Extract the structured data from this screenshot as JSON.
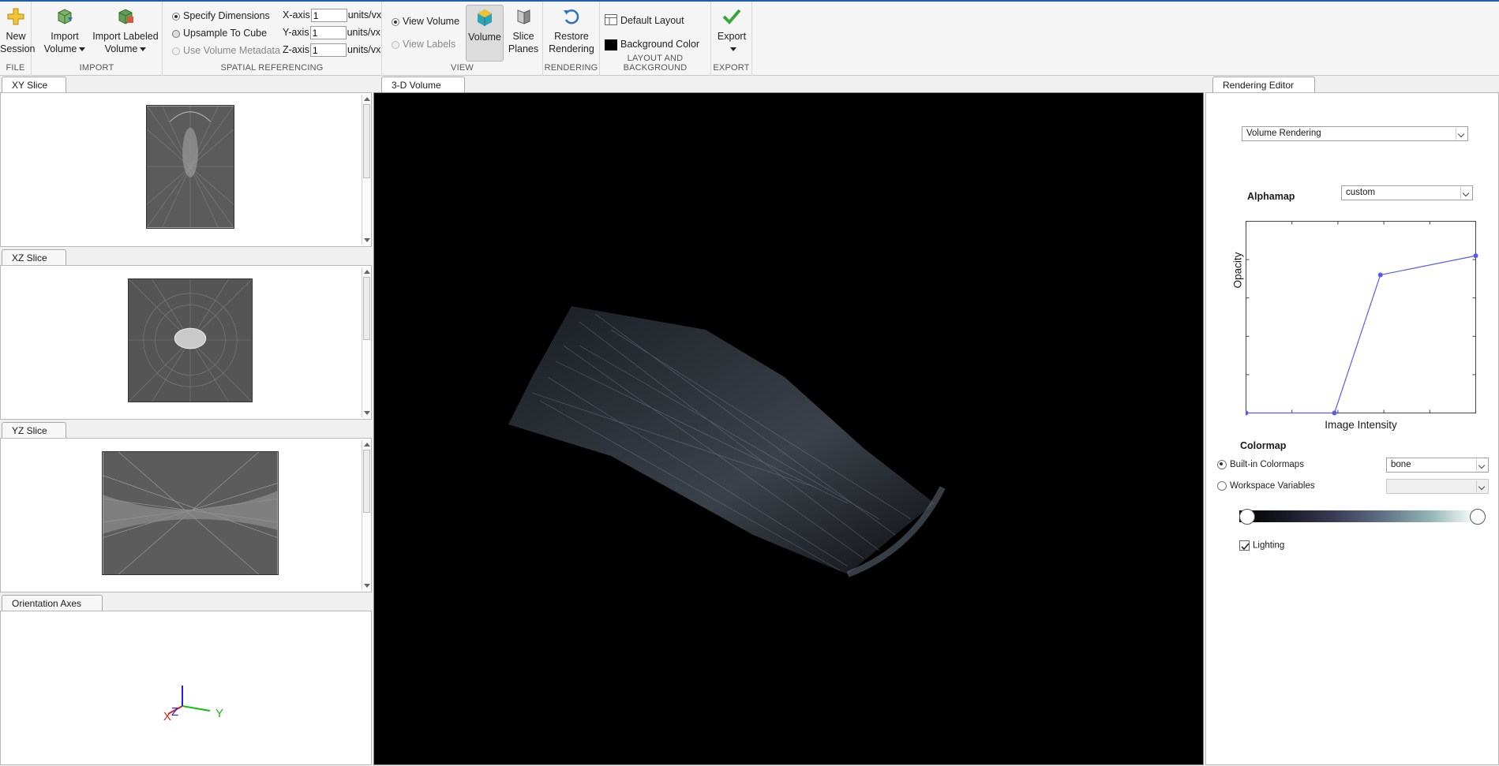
{
  "toolstrip": {
    "file": {
      "title": "FILE",
      "new_session": [
        "New",
        "Session"
      ]
    },
    "import": {
      "title": "IMPORT",
      "import_volume": [
        "Import",
        "Volume"
      ],
      "import_labeled": [
        "Import Labeled",
        "Volume"
      ]
    },
    "spatial": {
      "title": "SPATIAL REFERENCING",
      "options": [
        "Specify Dimensions",
        "Upsample To Cube",
        "Use Volume Metadata"
      ],
      "axes": [
        {
          "label": "X-axis",
          "value": "1",
          "units": "units/vx"
        },
        {
          "label": "Y-axis",
          "value": "1",
          "units": "units/vx"
        },
        {
          "label": "Z-axis",
          "value": "1",
          "units": "units/vx"
        }
      ]
    },
    "view": {
      "title": "VIEW",
      "view_volume": "View Volume",
      "view_labels": "View Labels",
      "volume": "Volume",
      "slice_planes": [
        "Slice",
        "Planes"
      ]
    },
    "rendering": {
      "title": "RENDERING",
      "restore": [
        "Restore",
        "Rendering"
      ]
    },
    "layout": {
      "title": "LAYOUT AND BACKGROUND",
      "default_layout": "Default Layout",
      "background_color": "Background Color"
    },
    "export": {
      "title": "EXPORT",
      "export": "Export"
    }
  },
  "left_panels": {
    "xy": "XY Slice",
    "xz": "XZ Slice",
    "yz": "YZ Slice",
    "orientation": "Orientation Axes",
    "axis_labels": {
      "x": "X",
      "y": "Y",
      "z": "Z"
    }
  },
  "center": {
    "tab": "3-D Volume"
  },
  "editor": {
    "tab": "Rendering Editor",
    "rendering_mode": "Volume Rendering",
    "alphamap_label": "Alphamap",
    "alphamap_value": "custom",
    "alphamap_plot": {
      "xlabel": "Image Intensity",
      "ylabel": "Opacity",
      "control_points": [
        [
          0,
          0
        ],
        [
          0.385,
          0
        ],
        [
          0.585,
          0.72
        ],
        [
          1,
          0.82
        ]
      ],
      "curve_color": "#5a5af0"
    },
    "colormap_label": "Colormap",
    "builtin_label": "Built-in Colormaps",
    "builtin_value": "bone",
    "workspace_label": "Workspace Variables",
    "workspace_value": "",
    "lighting_label": "Lighting",
    "lighting_checked": true
  },
  "colors": {
    "accent": "#1f5ea8",
    "axis_x": "#e02020",
    "axis_y": "#10c010",
    "axis_z": "#2020e0"
  }
}
